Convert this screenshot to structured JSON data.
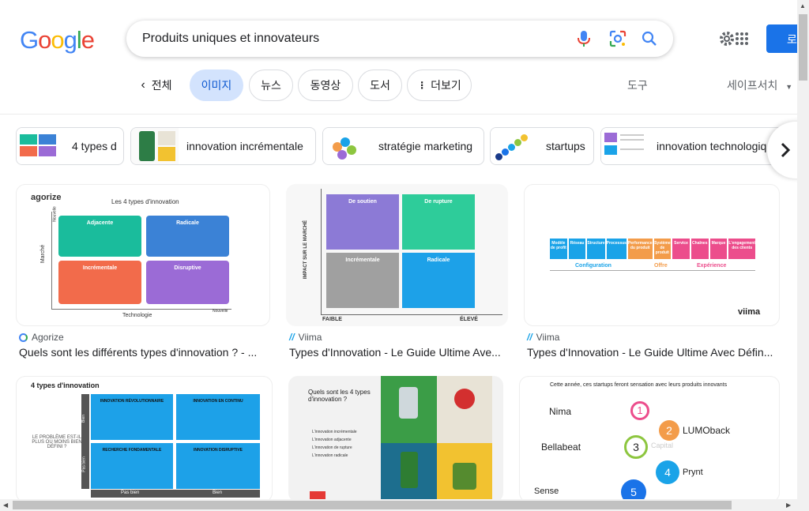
{
  "header": {
    "logo": [
      "G",
      "o",
      "o",
      "g",
      "l",
      "e"
    ],
    "logo_colors": [
      "#4285F4",
      "#EA4335",
      "#FBBC05",
      "#4285F4",
      "#34A853",
      "#EA4335"
    ],
    "search_value": "Produits uniques et innovateurs",
    "login_label": "로"
  },
  "tabs": {
    "all": "전체",
    "images": "이미지",
    "news": "뉴스",
    "videos": "동영상",
    "books": "도서",
    "more": "더보기",
    "tools": "도구",
    "safesearch": "세이프서치"
  },
  "chips": [
    {
      "label": "4 types d"
    },
    {
      "label": "innovation incrémentale"
    },
    {
      "label": "stratégie marketing"
    },
    {
      "label": "startups"
    },
    {
      "label": "innovation technologiq"
    }
  ],
  "results": [
    {
      "source": "Agorize",
      "title": "Quels sont les différents types d'innovation ? - ...",
      "art": {
        "brand": "agorize",
        "heading": "Les 4 types d'innovation",
        "quadrants": [
          "Adjacente",
          "Radicale",
          "Incrémentale",
          "Disruptive"
        ],
        "x_axis": "Technologie",
        "y_axis": "Marché",
        "x_corner": "Nouvelle",
        "y_corner": "Nouvelle",
        "colors": [
          "#1abc9c",
          "#3b82d6",
          "#f26b4b",
          "#9b6bd6"
        ]
      }
    },
    {
      "source": "Viima",
      "title": "Types d'Innovation - Le Guide Ultime Ave...",
      "art": {
        "quadrants": [
          "De soutien",
          "De rupture",
          "Incrémentale",
          "Radicale"
        ],
        "x_low": "FAIBLE",
        "x_high": "ÉLEVÉ",
        "y_axis": "IMPACT SUR LE MARCHÉ",
        "colors": [
          "#8c7ad6",
          "#2ecc9a",
          "#a0a0a0",
          "#1da1e8"
        ]
      }
    },
    {
      "source": "Viima",
      "title": "Types d'Innovation - Le Guide Ultime Avec Défin...",
      "art": {
        "groups": [
          "Configuration",
          "Offre",
          "Expérience"
        ],
        "cells": [
          "Modèle de profit",
          "Réseau",
          "Structure",
          "Processus",
          "Performance du produit",
          "Système de produit",
          "Service",
          "Chaînes",
          "Marque",
          "L'engagement des clients"
        ],
        "colors": [
          "#1aa3e8",
          "#1aa3e8",
          "#1aa3e8",
          "#1aa3e8",
          "#f39c4a",
          "#f39c4a",
          "#ec4d8c",
          "#ec4d8c",
          "#ec4d8c",
          "#ec4d8c"
        ],
        "brand": "viima"
      }
    },
    {
      "art": {
        "heading": "4 types d'innovation",
        "quadrants": [
          "INNOVATION RÉVOLUTIONNAIRE",
          "INNOVATION EN CONTINU",
          "RECHERCHE FONDAMENTALE",
          "INNOVATION DISRUPTIVE"
        ],
        "left_note": "LE PROBLÈME EST-IL PLUS OU MOINS BIEN DÉFINI ?",
        "row_labels": [
          "Bien",
          "Pas bien"
        ],
        "col_labels": [
          "Pas bien",
          "Bien"
        ]
      }
    },
    {
      "art": {
        "heading": "Quels sont les 4 types d'innovation ?",
        "items": [
          "L'innovation incrémentale",
          "L'innovation adjacente",
          "L'innovation de rupture",
          "L'innovation radicale"
        ]
      }
    },
    {
      "art": {
        "heading": "Cette année, ces startups feront sensation avec leurs produits innovants",
        "names_left": [
          "Nima",
          "Bellabeat",
          "Sense"
        ],
        "names_right": [
          "LUMOback",
          "Prynt"
        ],
        "numbers": [
          "1",
          "2",
          "3",
          "4",
          "5"
        ],
        "number_colors": [
          "#ec4d8c",
          "#f39c4a",
          "#8dc63f",
          "#1aa3e8",
          "#1a73e8"
        ],
        "faded_label": "Capital"
      }
    }
  ]
}
